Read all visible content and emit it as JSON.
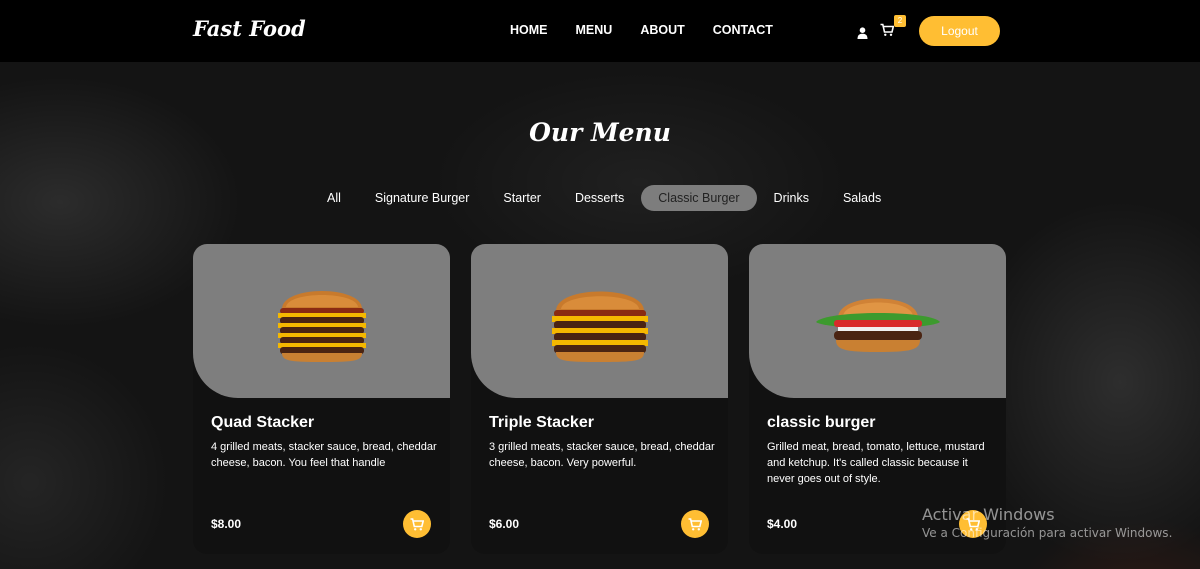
{
  "brand": {
    "logo": "Fast Food"
  },
  "nav": {
    "home": "HOME",
    "menu": "MENU",
    "about": "ABOUT",
    "contact": "CONTACT"
  },
  "header": {
    "cart_count": "2",
    "logout": "Logout"
  },
  "section": {
    "title": "Our Menu"
  },
  "filters": [
    "All",
    "Signature Burger",
    "Starter",
    "Desserts",
    "Classic Burger",
    "Drinks",
    "Salads"
  ],
  "active_filter": "Classic Burger",
  "cards": [
    {
      "title": "Quad Stacker",
      "desc": "4 grilled meats, stacker sauce, bread, cheddar cheese, bacon. You feel that handle",
      "price": "$8.00",
      "icon": "burger-image"
    },
    {
      "title": "Triple Stacker",
      "desc": "3 grilled meats, stacker sauce, bread, cheddar cheese, bacon. Very powerful.",
      "price": "$6.00",
      "icon": "burger-image"
    },
    {
      "title": "classic burger",
      "desc": "Grilled meat, bread, tomato, lettuce, mustard and ketchup. It's called classic because it never goes out of style.",
      "price": "$4.00",
      "icon": "burger-image"
    }
  ],
  "watermark": {
    "title": "Activar Windows",
    "subtitle": "Ve a Configuración para activar Windows."
  },
  "colors": {
    "accent": "#ffbe33",
    "card_bg": "#111111",
    "image_bg": "#7e7e7e"
  }
}
